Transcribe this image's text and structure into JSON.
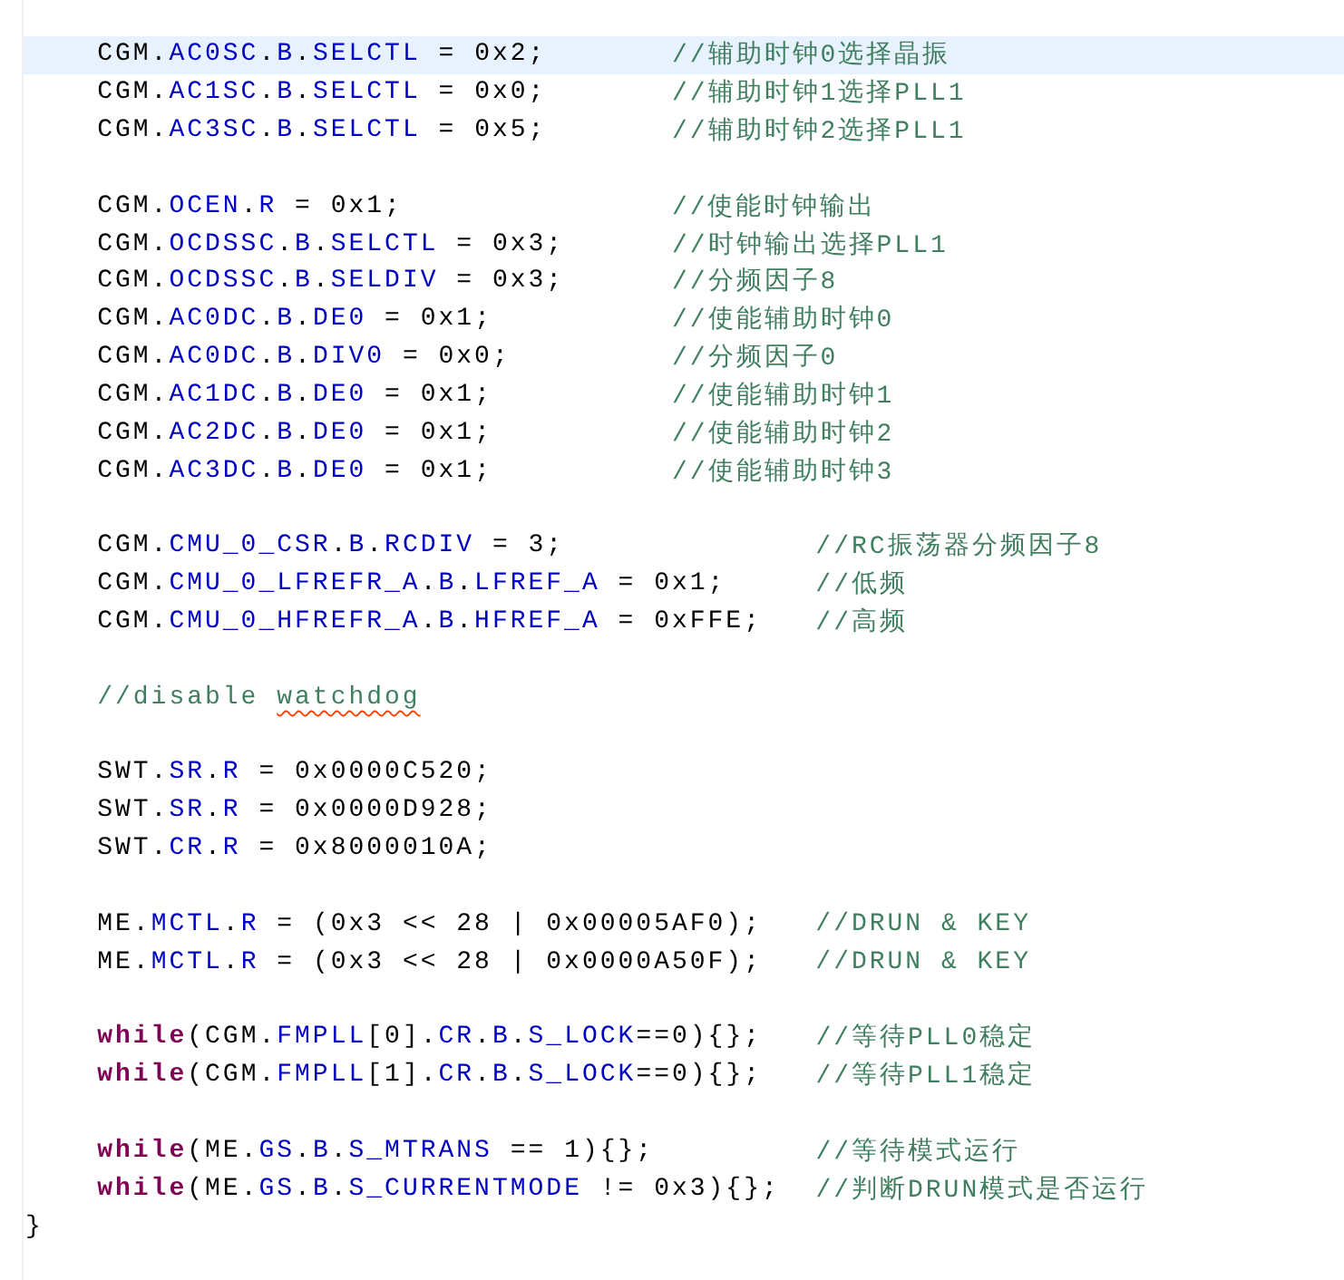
{
  "editor": {
    "body": [
      {
        "lines": [
          {
            "current": true,
            "code": [
              {
                "kind": "text",
                "text": "CGM."
              },
              {
                "kind": "member",
                "text": "AC0SC"
              },
              {
                "kind": "text",
                "text": "."
              },
              {
                "kind": "member",
                "text": "B"
              },
              {
                "kind": "text",
                "text": "."
              },
              {
                "kind": "member",
                "text": "SELCTL"
              },
              {
                "kind": "text",
                "text": " = 0x2;"
              }
            ],
            "comment": "//辅助时钟0选择晶振"
          },
          {
            "current": false,
            "code": [
              {
                "kind": "text",
                "text": "CGM."
              },
              {
                "kind": "member",
                "text": "AC1SC"
              },
              {
                "kind": "text",
                "text": "."
              },
              {
                "kind": "member",
                "text": "B"
              },
              {
                "kind": "text",
                "text": "."
              },
              {
                "kind": "member",
                "text": "SELCTL"
              },
              {
                "kind": "text",
                "text": " = 0x0;"
              }
            ],
            "comment": "//辅助时钟1选择PLL1"
          },
          {
            "current": false,
            "code": [
              {
                "kind": "text",
                "text": "CGM."
              },
              {
                "kind": "member",
                "text": "AC3SC"
              },
              {
                "kind": "text",
                "text": "."
              },
              {
                "kind": "member",
                "text": "B"
              },
              {
                "kind": "text",
                "text": "."
              },
              {
                "kind": "member",
                "text": "SELCTL"
              },
              {
                "kind": "text",
                "text": " = 0x5;"
              }
            ],
            "comment": "//辅助时钟2选择PLL1"
          }
        ]
      },
      {
        "lines": [
          {
            "current": false,
            "code": [
              {
                "kind": "text",
                "text": "CGM."
              },
              {
                "kind": "member",
                "text": "OCEN"
              },
              {
                "kind": "text",
                "text": "."
              },
              {
                "kind": "member",
                "text": "R"
              },
              {
                "kind": "text",
                "text": " = 0x1;"
              }
            ],
            "comment": "//使能时钟输出"
          },
          {
            "current": false,
            "code": [
              {
                "kind": "text",
                "text": "CGM."
              },
              {
                "kind": "member",
                "text": "OCDSSC"
              },
              {
                "kind": "text",
                "text": "."
              },
              {
                "kind": "member",
                "text": "B"
              },
              {
                "kind": "text",
                "text": "."
              },
              {
                "kind": "member",
                "text": "SELCTL"
              },
              {
                "kind": "text",
                "text": " = 0x3;"
              }
            ],
            "comment": "//时钟输出选择PLL1"
          },
          {
            "current": false,
            "code": [
              {
                "kind": "text",
                "text": "CGM."
              },
              {
                "kind": "member",
                "text": "OCDSSC"
              },
              {
                "kind": "text",
                "text": "."
              },
              {
                "kind": "member",
                "text": "B"
              },
              {
                "kind": "text",
                "text": "."
              },
              {
                "kind": "member",
                "text": "SELDIV"
              },
              {
                "kind": "text",
                "text": " = 0x3;"
              }
            ],
            "comment": "//分频因子8"
          },
          {
            "current": false,
            "code": [
              {
                "kind": "text",
                "text": "CGM."
              },
              {
                "kind": "member",
                "text": "AC0DC"
              },
              {
                "kind": "text",
                "text": "."
              },
              {
                "kind": "member",
                "text": "B"
              },
              {
                "kind": "text",
                "text": "."
              },
              {
                "kind": "member",
                "text": "DE0"
              },
              {
                "kind": "text",
                "text": " = 0x1;"
              }
            ],
            "comment": "//使能辅助时钟0"
          },
          {
            "current": false,
            "code": [
              {
                "kind": "text",
                "text": "CGM."
              },
              {
                "kind": "member",
                "text": "AC0DC"
              },
              {
                "kind": "text",
                "text": "."
              },
              {
                "kind": "member",
                "text": "B"
              },
              {
                "kind": "text",
                "text": "."
              },
              {
                "kind": "member",
                "text": "DIV0"
              },
              {
                "kind": "text",
                "text": " = 0x0;"
              }
            ],
            "comment": "//分频因子0"
          },
          {
            "current": false,
            "code": [
              {
                "kind": "text",
                "text": "CGM."
              },
              {
                "kind": "member",
                "text": "AC1DC"
              },
              {
                "kind": "text",
                "text": "."
              },
              {
                "kind": "member",
                "text": "B"
              },
              {
                "kind": "text",
                "text": "."
              },
              {
                "kind": "member",
                "text": "DE0"
              },
              {
                "kind": "text",
                "text": " = 0x1;"
              }
            ],
            "comment": "//使能辅助时钟1"
          },
          {
            "current": false,
            "code": [
              {
                "kind": "text",
                "text": "CGM."
              },
              {
                "kind": "member",
                "text": "AC2DC"
              },
              {
                "kind": "text",
                "text": "."
              },
              {
                "kind": "member",
                "text": "B"
              },
              {
                "kind": "text",
                "text": "."
              },
              {
                "kind": "member",
                "text": "DE0"
              },
              {
                "kind": "text",
                "text": " = 0x1;"
              }
            ],
            "comment": "//使能辅助时钟2"
          },
          {
            "current": false,
            "code": [
              {
                "kind": "text",
                "text": "CGM."
              },
              {
                "kind": "member",
                "text": "AC3DC"
              },
              {
                "kind": "text",
                "text": "."
              },
              {
                "kind": "member",
                "text": "B"
              },
              {
                "kind": "text",
                "text": "."
              },
              {
                "kind": "member",
                "text": "DE0"
              },
              {
                "kind": "text",
                "text": " = 0x1;"
              }
            ],
            "comment": "//使能辅助时钟3"
          }
        ]
      },
      {
        "lines": [
          {
            "current": false,
            "code": [
              {
                "kind": "text",
                "text": "CGM."
              },
              {
                "kind": "member",
                "text": "CMU_0_CSR"
              },
              {
                "kind": "text",
                "text": "."
              },
              {
                "kind": "member",
                "text": "B"
              },
              {
                "kind": "text",
                "text": "."
              },
              {
                "kind": "member",
                "text": "RCDIV"
              },
              {
                "kind": "text",
                "text": " = 3;"
              }
            ],
            "comment": "//RC振荡器分频因子8"
          },
          {
            "current": false,
            "code": [
              {
                "kind": "text",
                "text": "CGM."
              },
              {
                "kind": "member",
                "text": "CMU_0_LFREFR_A"
              },
              {
                "kind": "text",
                "text": "."
              },
              {
                "kind": "member",
                "text": "B"
              },
              {
                "kind": "text",
                "text": "."
              },
              {
                "kind": "member",
                "text": "LFREF_A"
              },
              {
                "kind": "text",
                "text": " = 0x1;"
              }
            ],
            "comment": "//低频"
          },
          {
            "current": false,
            "code": [
              {
                "kind": "text",
                "text": "CGM."
              },
              {
                "kind": "member",
                "text": "CMU_0_HFREFR_A"
              },
              {
                "kind": "text",
                "text": "."
              },
              {
                "kind": "member",
                "text": "B"
              },
              {
                "kind": "text",
                "text": "."
              },
              {
                "kind": "member",
                "text": "HFREF_A"
              },
              {
                "kind": "text",
                "text": " = 0xFFE;"
              }
            ],
            "comment": "//高频"
          }
        ]
      },
      {
        "lines": [
          {
            "current": false,
            "comment_parts": [
              {
                "text": "//disable ",
                "misspelled": false
              },
              {
                "text": "watchdog",
                "misspelled": true
              }
            ]
          }
        ]
      },
      {
        "lines": [
          {
            "current": false,
            "code": [
              {
                "kind": "text",
                "text": "SWT."
              },
              {
                "kind": "member",
                "text": "SR"
              },
              {
                "kind": "text",
                "text": "."
              },
              {
                "kind": "member",
                "text": "R"
              },
              {
                "kind": "text",
                "text": " = 0x0000C520;"
              }
            ]
          },
          {
            "current": false,
            "code": [
              {
                "kind": "text",
                "text": "SWT."
              },
              {
                "kind": "member",
                "text": "SR"
              },
              {
                "kind": "text",
                "text": "."
              },
              {
                "kind": "member",
                "text": "R"
              },
              {
                "kind": "text",
                "text": " = 0x0000D928;"
              }
            ]
          },
          {
            "current": false,
            "code": [
              {
                "kind": "text",
                "text": "SWT."
              },
              {
                "kind": "member",
                "text": "CR"
              },
              {
                "kind": "text",
                "text": "."
              },
              {
                "kind": "member",
                "text": "R"
              },
              {
                "kind": "text",
                "text": " = 0x8000010A;"
              }
            ]
          }
        ]
      },
      {
        "lines": [
          {
            "current": false,
            "code": [
              {
                "kind": "text",
                "text": "ME."
              },
              {
                "kind": "member",
                "text": "MCTL"
              },
              {
                "kind": "text",
                "text": "."
              },
              {
                "kind": "member",
                "text": "R"
              },
              {
                "kind": "text",
                "text": " = (0x3 << 28 | 0x00005AF0);"
              }
            ],
            "comment": "//DRUN & KEY"
          },
          {
            "current": false,
            "code": [
              {
                "kind": "text",
                "text": "ME."
              },
              {
                "kind": "member",
                "text": "MCTL"
              },
              {
                "kind": "text",
                "text": "."
              },
              {
                "kind": "member",
                "text": "R"
              },
              {
                "kind": "text",
                "text": " = (0x3 << 28 | 0x0000A50F);"
              }
            ],
            "comment": "//DRUN & KEY"
          }
        ]
      },
      {
        "lines": [
          {
            "current": false,
            "code": [
              {
                "kind": "keyword",
                "text": "while"
              },
              {
                "kind": "text",
                "text": "(CGM."
              },
              {
                "kind": "member",
                "text": "FMPLL"
              },
              {
                "kind": "text",
                "text": "[0]."
              },
              {
                "kind": "member",
                "text": "CR"
              },
              {
                "kind": "text",
                "text": "."
              },
              {
                "kind": "member",
                "text": "B"
              },
              {
                "kind": "text",
                "text": "."
              },
              {
                "kind": "member",
                "text": "S_LOCK"
              },
              {
                "kind": "text",
                "text": "==0){};"
              }
            ],
            "comment": "//等待PLL0稳定"
          },
          {
            "current": false,
            "code": [
              {
                "kind": "keyword",
                "text": "while"
              },
              {
                "kind": "text",
                "text": "(CGM."
              },
              {
                "kind": "member",
                "text": "FMPLL"
              },
              {
                "kind": "text",
                "text": "[1]."
              },
              {
                "kind": "member",
                "text": "CR"
              },
              {
                "kind": "text",
                "text": "."
              },
              {
                "kind": "member",
                "text": "B"
              },
              {
                "kind": "text",
                "text": "."
              },
              {
                "kind": "member",
                "text": "S_LOCK"
              },
              {
                "kind": "text",
                "text": "==0){};"
              }
            ],
            "comment": "//等待PLL1稳定"
          }
        ]
      },
      {
        "lines": [
          {
            "current": false,
            "code": [
              {
                "kind": "keyword",
                "text": "while"
              },
              {
                "kind": "text",
                "text": "(ME."
              },
              {
                "kind": "member",
                "text": "GS"
              },
              {
                "kind": "text",
                "text": "."
              },
              {
                "kind": "member",
                "text": "B"
              },
              {
                "kind": "text",
                "text": "."
              },
              {
                "kind": "member",
                "text": "S_MTRANS"
              },
              {
                "kind": "text",
                "text": " == 1){};"
              }
            ],
            "comment": "//等待模式运行"
          },
          {
            "current": false,
            "code": [
              {
                "kind": "keyword",
                "text": "while"
              },
              {
                "kind": "text",
                "text": "(ME."
              },
              {
                "kind": "member",
                "text": "GS"
              },
              {
                "kind": "text",
                "text": "."
              },
              {
                "kind": "member",
                "text": "B"
              },
              {
                "kind": "text",
                "text": "."
              },
              {
                "kind": "member",
                "text": "S_CURRENTMODE"
              },
              {
                "kind": "text",
                "text": " != 0x3){};"
              }
            ],
            "comment": "//判断DRUN模式是否运行"
          }
        ]
      }
    ],
    "closing_brace": "}"
  }
}
